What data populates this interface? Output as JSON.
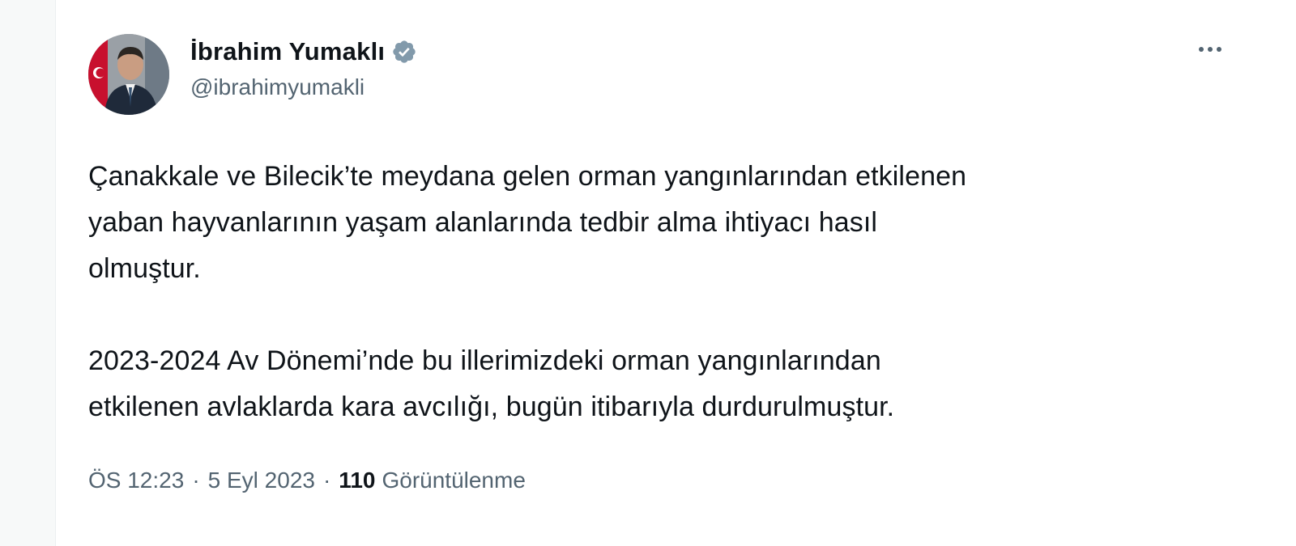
{
  "author": {
    "display_name": "İbrahim Yumaklı",
    "handle": "@ibrahimyumakli",
    "verified": true
  },
  "icons": {
    "verified": "verified-badge-icon",
    "more": "more-options-icon"
  },
  "colors": {
    "text_primary": "#0f1419",
    "text_secondary": "#536471",
    "verified_badge": "#829aab"
  },
  "tweet": {
    "paragraphs": [
      "Çanakkale ve Bilecik’te meydana gelen orman yangınlarından etkilenen\nyaban hayvanlarının yaşam alanlarında tedbir alma ihtiyacı hasıl\nolmuştur.",
      "2023-2024 Av Dönemi’nde bu illerimizdeki orman yangınlarından\netkilenen avlaklarda kara avcılığı, bugün itibarıyla durdurulmuştur."
    ],
    "time": "ÖS 12:23",
    "date": "5 Eyl 2023",
    "separator": "·",
    "views_count": "110",
    "views_label": "Görüntülenme"
  }
}
